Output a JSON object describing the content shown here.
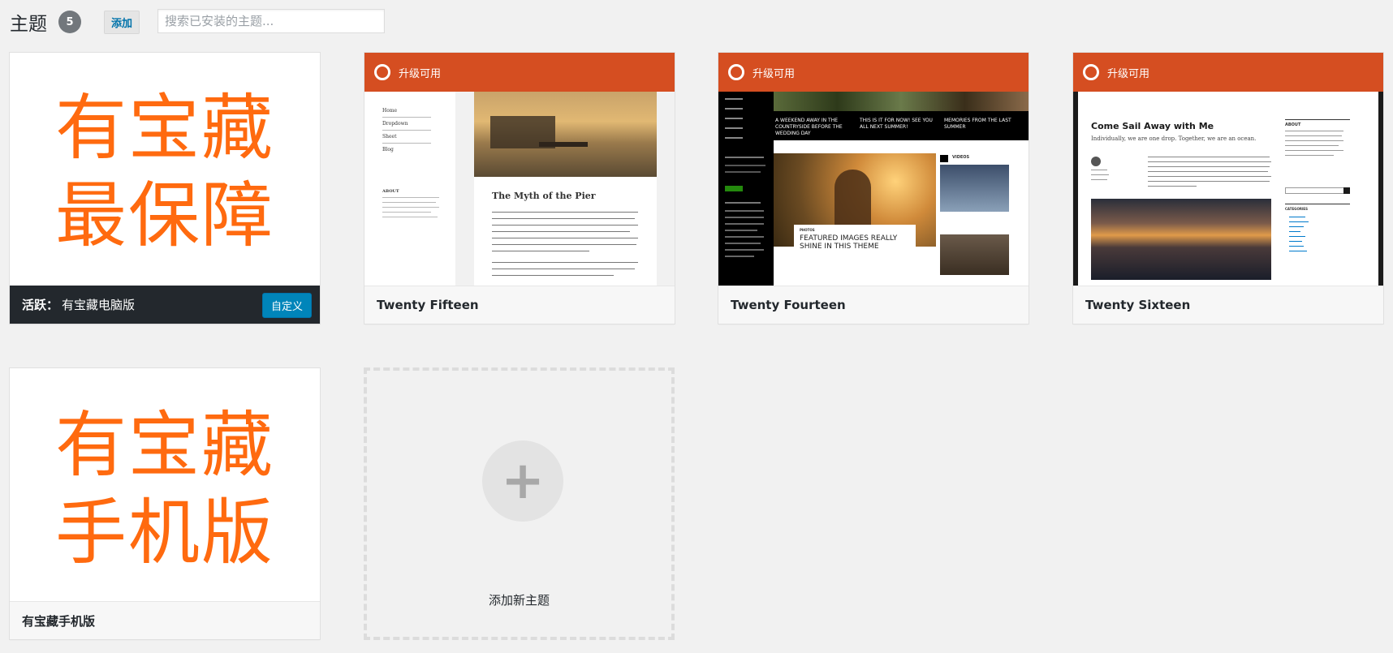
{
  "header": {
    "title": "主题",
    "count": "5",
    "add_button": "添加",
    "search_placeholder": "搜索已安装的主题..."
  },
  "themes": [
    {
      "name": "有宝藏电脑版",
      "active": true,
      "active_label": "活跃：",
      "customize_label": "自定义",
      "screenshot_text": [
        "有宝藏",
        "最保障"
      ]
    },
    {
      "name": "Twenty Fifteen",
      "update_label": "升级可用",
      "screenshot": {
        "post_title": "The Myth of the Pier",
        "nav": [
          "Home",
          "Dropdown",
          "Sheet",
          "Blog"
        ],
        "sidebar_heading": "ABOUT"
      }
    },
    {
      "name": "Twenty Fourteen",
      "update_label": "升级可用",
      "screenshot": {
        "headline1": "A WEEKEND AWAY IN THE COUNTRYSIDE BEFORE THE WEDDING DAY",
        "headline2": "THIS IS IT FOR NOW! SEE YOU ALL NEXT SUMMER!",
        "headline3": "MEMORIES FROM THE LAST SUMMER",
        "feature_title": "FEATURED IMAGES REALLY SHINE IN THIS THEME",
        "videos_label": "VIDEOS"
      }
    },
    {
      "name": "Twenty Sixteen",
      "update_label": "升级可用",
      "screenshot": {
        "post_title": "Come Sail Away with Me",
        "subtitle": "Individually, we are one drop. Together, we are an ocean.",
        "about": "ABOUT",
        "categories": "CATEGORIES"
      }
    },
    {
      "name": "有宝藏手机版",
      "active": false,
      "screenshot_text": [
        "有宝藏",
        "手机版"
      ]
    }
  ],
  "add_new": {
    "label": "添加新主题"
  },
  "colors": {
    "accent_orange": "#ff6a0f",
    "update_banner": "#d54e21",
    "button_blue": "#0085ba"
  }
}
